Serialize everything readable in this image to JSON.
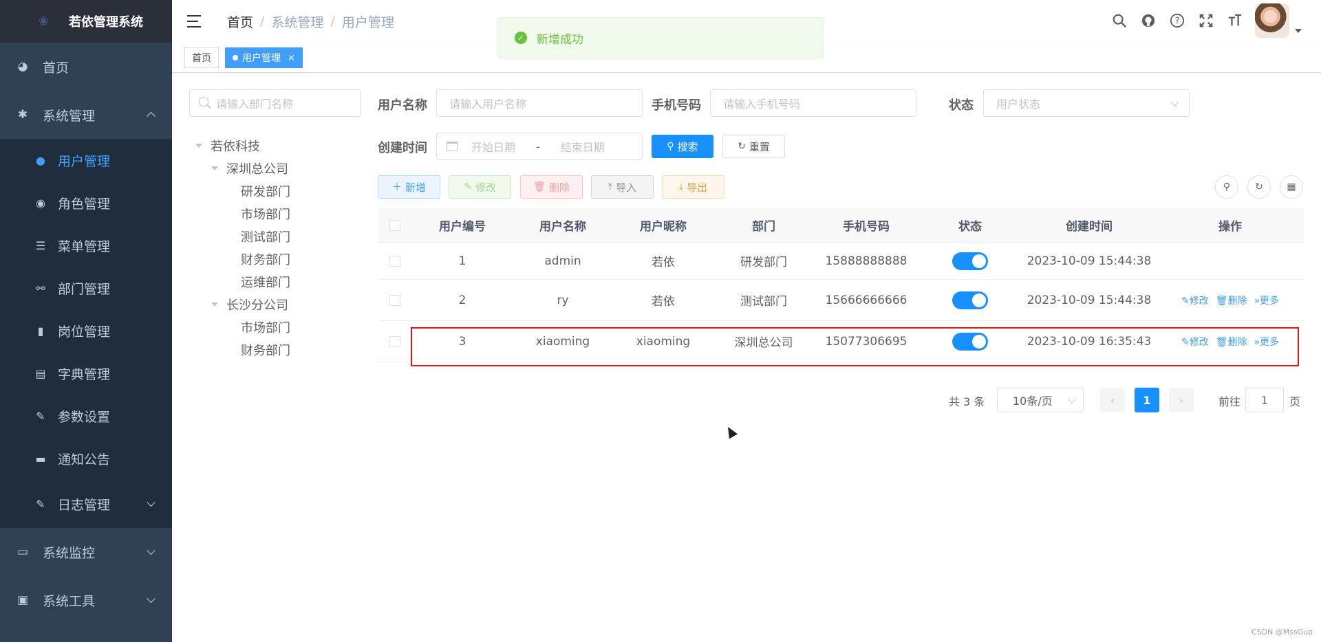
{
  "app": {
    "title": "若依管理系统"
  },
  "sidebar": {
    "items": [
      {
        "label": "首页",
        "icon": "dashboard-icon"
      },
      {
        "label": "系统管理",
        "icon": "gear-icon",
        "expanded": true,
        "children": [
          {
            "label": "用户管理",
            "icon": "user-icon",
            "active": true
          },
          {
            "label": "角色管理",
            "icon": "peoples-icon"
          },
          {
            "label": "菜单管理",
            "icon": "tree-table-icon"
          },
          {
            "label": "部门管理",
            "icon": "tree-icon"
          },
          {
            "label": "岗位管理",
            "icon": "post-icon"
          },
          {
            "label": "字典管理",
            "icon": "dict-icon"
          },
          {
            "label": "参数设置",
            "icon": "edit-icon"
          },
          {
            "label": "通知公告",
            "icon": "message-icon"
          },
          {
            "label": "日志管理",
            "icon": "log-icon"
          }
        ]
      },
      {
        "label": "系统监控",
        "icon": "monitor-icon"
      },
      {
        "label": "系统工具",
        "icon": "tool-icon"
      }
    ]
  },
  "breadcrumb": [
    "首页",
    "系统管理",
    "用户管理"
  ],
  "tags": [
    {
      "label": "首页"
    },
    {
      "label": "用户管理",
      "close": "×"
    }
  ],
  "toast": {
    "text": "新增成功"
  },
  "dept": {
    "search_placeholder": "请输入部门名称",
    "tree": [
      {
        "label": "若依科技",
        "level": 0
      },
      {
        "label": "深圳总公司",
        "level": 1
      },
      {
        "label": "研发部门",
        "level": 2
      },
      {
        "label": "市场部门",
        "level": 2
      },
      {
        "label": "测试部门",
        "level": 2
      },
      {
        "label": "财务部门",
        "level": 2
      },
      {
        "label": "运维部门",
        "level": 2
      },
      {
        "label": "长沙分公司",
        "level": 1
      },
      {
        "label": "市场部门",
        "level": 2
      },
      {
        "label": "财务部门",
        "level": 2
      }
    ]
  },
  "filters": {
    "username_label": "用户名称",
    "username_placeholder": "请输入用户名称",
    "phone_label": "手机号码",
    "phone_placeholder": "请输入手机号码",
    "status_label": "状态",
    "status_placeholder": "用户状态",
    "created_label": "创建时间",
    "start_placeholder": "开始日期",
    "range_sep": "-",
    "end_placeholder": "结束日期",
    "search_button": "搜索",
    "reset_button": "重置"
  },
  "toolbar": {
    "add": "新增",
    "edit": "修改",
    "delete": "删除",
    "import": "导入",
    "export": "导出"
  },
  "table": {
    "columns": [
      "用户编号",
      "用户名称",
      "用户昵称",
      "部门",
      "手机号码",
      "状态",
      "创建时间",
      "操作"
    ],
    "rows": [
      {
        "id": "1",
        "username": "admin",
        "nickname": "若依",
        "dept": "研发部门",
        "phone": "15888888888",
        "status": true,
        "created": "2023-10-09 15:44:38",
        "ops": []
      },
      {
        "id": "2",
        "username": "ry",
        "nickname": "若依",
        "dept": "测试部门",
        "phone": "15666666666",
        "status": true,
        "created": "2023-10-09 15:44:38",
        "ops": [
          "修改",
          "删除",
          "更多"
        ]
      },
      {
        "id": "3",
        "username": "xiaoming",
        "nickname": "xiaoming",
        "dept": "深圳总公司",
        "phone": "15077306695",
        "status": true,
        "created": "2023-10-09 16:35:43",
        "ops": [
          "修改",
          "删除",
          "更多"
        ]
      }
    ]
  },
  "pagination": {
    "total": "共 3 条",
    "page_size": "10条/页",
    "current": "1",
    "goto_label": "前往",
    "goto_value": "1",
    "page_suffix": "页"
  },
  "watermark": "CSDN @MssGuo",
  "colors": {
    "primary": "#1890ff",
    "sidebar_bg": "#304156",
    "highlight": "#e4141b",
    "success": "#67c23a"
  }
}
